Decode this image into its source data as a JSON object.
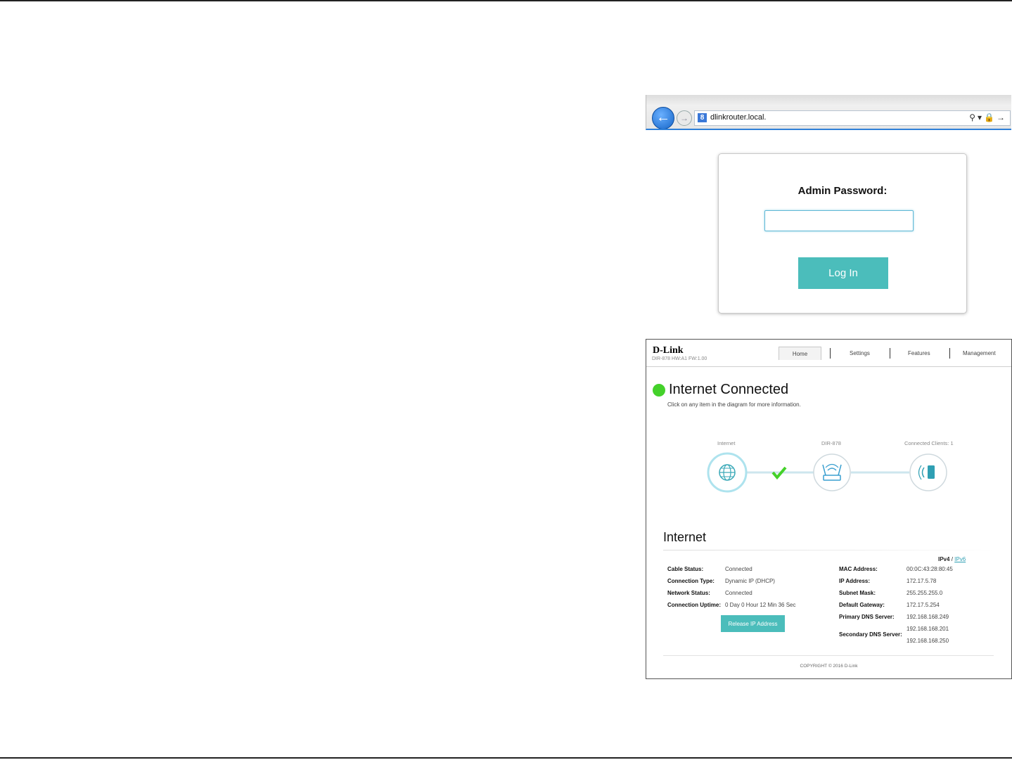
{
  "browser": {
    "url": "dlinkrouter.local."
  },
  "login": {
    "label": "Admin Password:",
    "button": "Log In"
  },
  "router": {
    "logo": "D-Link",
    "model_line": "DIR-878 HW:A1 FW:1.00",
    "nav": [
      "Home",
      "Settings",
      "Features",
      "Management"
    ],
    "status_title": "Internet Connected",
    "status_hint": "Click on any item in the diagram for more information.",
    "diagram": {
      "internet_label": "Internet",
      "router_label": "DIR-878",
      "clients_label": "Connected Clients: 1"
    },
    "section_title": "Internet",
    "ipv4": "IPv4",
    "separator": "/",
    "ipv6": "IPv6",
    "left_fields": [
      {
        "label": "Cable Status:",
        "value": "Connected"
      },
      {
        "label": "Connection Type:",
        "value": "Dynamic IP (DHCP)"
      },
      {
        "label": "Network Status:",
        "value": "Connected"
      },
      {
        "label": "Connection Uptime:",
        "value": "0 Day 0 Hour 12 Min 36 Sec"
      }
    ],
    "release_button": "Release IP Address",
    "right_fields": [
      {
        "label": "MAC Address:",
        "value": "00:0C:43:28:80:45"
      },
      {
        "label": "IP Address:",
        "value": "172.17.5.78"
      },
      {
        "label": "Subnet Mask:",
        "value": "255.255.255.0"
      },
      {
        "label": "Default Gateway:",
        "value": "172.17.5.254"
      },
      {
        "label": "Primary DNS Server:",
        "value": "192.168.168.249"
      },
      {
        "label": "Secondary DNS Server:",
        "value": "192.168.168.201"
      },
      {
        "label": "",
        "value": "192.168.168.250"
      }
    ],
    "copyright": "COPYRIGHT © 2016 D-Link",
    "colors": {
      "accent": "#4bbdbb",
      "status_ok": "#44d12a",
      "check": "#44d12a"
    }
  }
}
